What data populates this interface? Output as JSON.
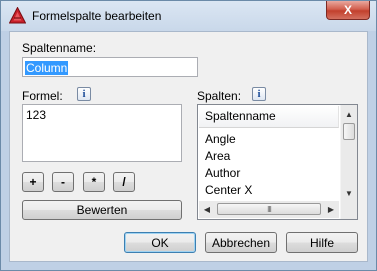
{
  "window": {
    "title": "Formelspalte bearbeiten",
    "close_glyph": "X",
    "icon": "autocad-logo-icon"
  },
  "column_name": {
    "label": "Spaltenname:",
    "value": "Column"
  },
  "formula": {
    "label": "Formel:",
    "value": "123",
    "info_glyph": "i"
  },
  "operators": [
    {
      "label": "+"
    },
    {
      "label": "-"
    },
    {
      "label": "*"
    },
    {
      "label": "/"
    }
  ],
  "evaluate_label": "Bewerten",
  "columns": {
    "label": "Spalten:",
    "info_glyph": "i",
    "header": "Spaltenname",
    "items": [
      "Angle",
      "Area",
      "Author",
      "Center X"
    ],
    "hscroll_grip": "III"
  },
  "footer": {
    "ok_label": "OK",
    "cancel_label": "Abbrechen",
    "help_label": "Hilfe"
  },
  "colors": {
    "selection": "#3399ff",
    "title_gradient": "#c9d8ea",
    "close_button": "#c2402d"
  }
}
